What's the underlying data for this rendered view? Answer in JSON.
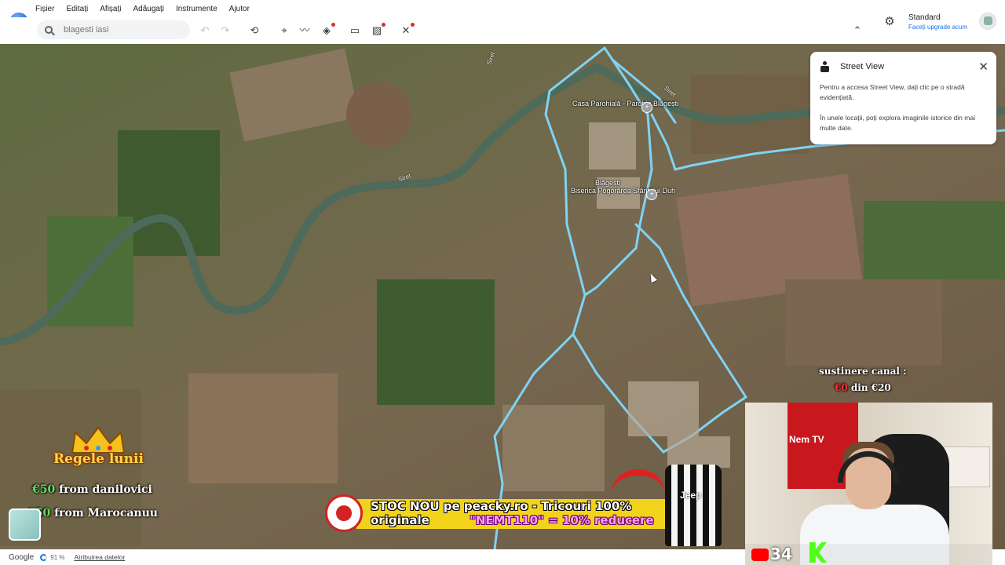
{
  "menu": [
    "Fișier",
    "Editați",
    "Afișați",
    "Adăugați",
    "Instrumente",
    "Ajutor"
  ],
  "search": {
    "placeholder": "blagesti iasi"
  },
  "toolbar_icons": [
    "undo-icon",
    "redo-icon",
    "history-icon",
    "placemark-icon",
    "path-icon",
    "layers-icon",
    "measure-icon",
    "image-overlay-icon",
    "tools-icon",
    "collapse-icon"
  ],
  "account": {
    "plan": "Standard",
    "upgrade": "Faceți upgrade acum"
  },
  "map": {
    "pois": [
      {
        "label": "Casa Parohială - Parohia Blăgești"
      },
      {
        "label": "Biserica Pogorârea Sfântului Duh"
      },
      {
        "label": "Blăgești"
      }
    ],
    "rivers": [
      "Siret",
      "Siret",
      "Siret"
    ]
  },
  "street_view": {
    "title": "Street View",
    "p1": "Pentru a accesa Street View, dați clic pe o stradă evidențiată.",
    "p2": "În unele locații, poți explora imaginile istorice din mai multe date."
  },
  "overlay": {
    "support_title": "sustinere canal :",
    "support_current": "€0",
    "support_mid": " din ",
    "support_goal": "€20",
    "king_title": "Regele lunii",
    "donors": [
      {
        "amount": "€50",
        "text": " from danilovici"
      },
      {
        "amount": "€50",
        "text": " from Marocanuu"
      }
    ],
    "banner_line1": "STOC NOU pe peacky.ro - Tricouri 100%",
    "banner_line2a": "originale",
    "banner_line2b": "\"NEMT110\" = 10% reducere",
    "jersey_text": "Jeep",
    "cam_count": "34",
    "cam_shirt": "Nem TV"
  },
  "statusbar": {
    "brand": "Google",
    "percent": "91 %",
    "attribution": "Atribuirea datelor"
  },
  "colors": {
    "accent": "#1a73e8",
    "roads": "#7fd3f5",
    "banner": "#f2d31b"
  }
}
